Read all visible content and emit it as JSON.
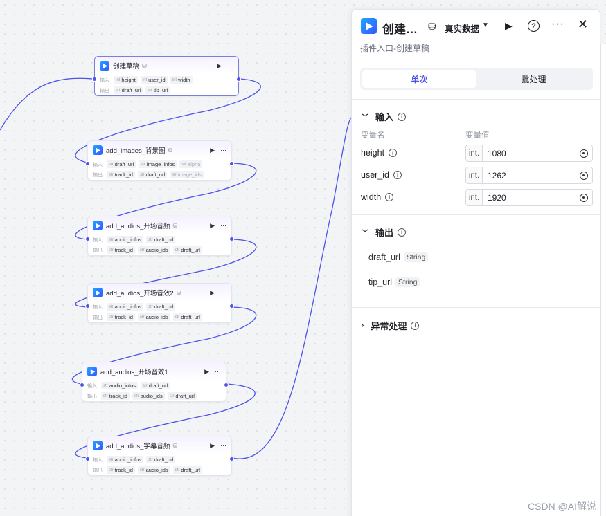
{
  "nodes": [
    {
      "title": "创建草稿",
      "inputs_label": "输入",
      "outputs_label": "输出",
      "inputs": [
        {
          "type": "int",
          "name": "height"
        },
        {
          "type": "int",
          "name": "user_id"
        },
        {
          "type": "int",
          "name": "width"
        }
      ],
      "outputs": [
        {
          "type": "str",
          "name": "draft_url"
        },
        {
          "type": "str",
          "name": "tip_url"
        }
      ]
    },
    {
      "title": "add_images_背景图",
      "inputs_label": "输入",
      "outputs_label": "输出",
      "inputs": [
        {
          "type": "str",
          "name": "draft_url"
        },
        {
          "type": "str",
          "name": "image_infos"
        },
        {
          "type": "str",
          "name": "alpha"
        }
      ],
      "outputs": [
        {
          "type": "str",
          "name": "track_id"
        },
        {
          "type": "str",
          "name": "draft_url"
        },
        {
          "type": "str",
          "name": "image_ids"
        }
      ]
    },
    {
      "title": "add_audios_开场音频",
      "inputs_label": "输入",
      "outputs_label": "输出",
      "inputs": [
        {
          "type": "str",
          "name": "audio_infos"
        },
        {
          "type": "str",
          "name": "draft_url"
        }
      ],
      "outputs": [
        {
          "type": "str",
          "name": "track_id"
        },
        {
          "type": "str",
          "name": "audio_ids"
        },
        {
          "type": "str",
          "name": "draft_url"
        }
      ]
    },
    {
      "title": "add_audios_开场音效2",
      "inputs_label": "输入",
      "outputs_label": "输出",
      "inputs": [
        {
          "type": "str",
          "name": "audio_infos"
        },
        {
          "type": "str",
          "name": "draft_url"
        }
      ],
      "outputs": [
        {
          "type": "str",
          "name": "track_id"
        },
        {
          "type": "str",
          "name": "audio_ids"
        },
        {
          "type": "str",
          "name": "draft_url"
        }
      ]
    },
    {
      "title": "add_audios_开场音效1",
      "inputs_label": "输入",
      "outputs_label": "输出",
      "inputs": [
        {
          "type": "str",
          "name": "audio_infos"
        },
        {
          "type": "str",
          "name": "draft_url"
        }
      ],
      "outputs": [
        {
          "type": "str",
          "name": "track_id"
        },
        {
          "type": "str",
          "name": "audio_ids"
        },
        {
          "type": "str",
          "name": "draft_url"
        }
      ]
    },
    {
      "title": "add_audios_字幕音频",
      "inputs_label": "输入",
      "outputs_label": "输出",
      "inputs": [
        {
          "type": "str",
          "name": "audio_infos"
        },
        {
          "type": "str",
          "name": "draft_url"
        }
      ],
      "outputs": [
        {
          "type": "str",
          "name": "track_id"
        },
        {
          "type": "str",
          "name": "audio_ids"
        },
        {
          "type": "str",
          "name": "draft_url"
        }
      ]
    }
  ],
  "panel": {
    "title": "创建…",
    "data_mode": "真实数据",
    "subtitle": "插件入口-创建草稿",
    "tabs": [
      "单次",
      "批处理"
    ],
    "input_section": "输入",
    "col_name": "变量名",
    "col_value": "变量值",
    "variables": [
      {
        "name": "height",
        "type": "int.",
        "value": "1080"
      },
      {
        "name": "user_id",
        "type": "int.",
        "value": "1262"
      },
      {
        "name": "width",
        "type": "int.",
        "value": "1920"
      }
    ],
    "output_section": "输出",
    "outputs": [
      {
        "name": "draft_url",
        "type": "String"
      },
      {
        "name": "tip_url",
        "type": "String"
      }
    ],
    "error_section": "异常处理"
  },
  "watermark": "CSDN @AI解说",
  "colors": {
    "accent": "#4d53e8",
    "edge": "#4d53e8"
  }
}
